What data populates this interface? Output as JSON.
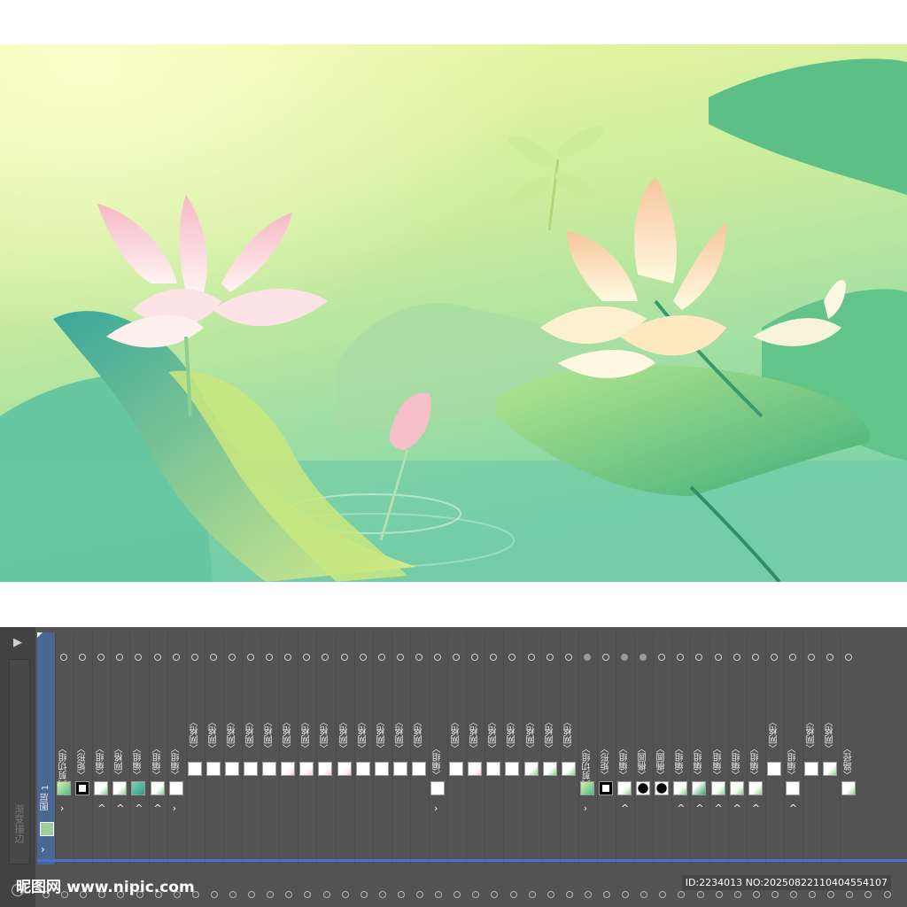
{
  "artwork": {
    "description_colors": {
      "sky_light": "#f0f7a8",
      "water": "#5fc6a6",
      "leaf_dark": "#2a9d7a",
      "lotus_pink": "#f7c9cf",
      "lotus_cream": "#fbe9c4"
    }
  },
  "panel": {
    "play_symbol": "▶",
    "side_label": "渐变描边",
    "layer_name": "图层 1",
    "accent": "#4a6fd1",
    "columns": [
      {
        "label": "〈剪切组〉",
        "thumb": "art",
        "caret": "›"
      },
      {
        "label": "〈矩形〉",
        "thumb": "frame",
        "caret": ""
      },
      {
        "label": "〈编组〉",
        "thumb": "leaf",
        "caret": "^"
      },
      {
        "label": "〈网格〉",
        "thumb": "leaf",
        "caret": "^"
      },
      {
        "label": "〈编组〉",
        "thumb": "teal",
        "caret": "^"
      },
      {
        "label": "〈编组〉",
        "thumb": "leaf",
        "caret": "^"
      },
      {
        "label": "〈编组〉",
        "thumb": "white",
        "caret": "›"
      },
      {
        "label": "〈网格〉",
        "thumb": "white",
        "caret": ""
      },
      {
        "label": "〈网格〉",
        "thumb": "white",
        "caret": ""
      },
      {
        "label": "〈网格〉",
        "thumb": "white",
        "caret": ""
      },
      {
        "label": "〈网格〉",
        "thumb": "white",
        "caret": ""
      },
      {
        "label": "〈网格〉",
        "thumb": "white",
        "caret": ""
      },
      {
        "label": "〈网格〉",
        "thumb": "pink",
        "caret": ""
      },
      {
        "label": "〈网格〉",
        "thumb": "pink",
        "caret": ""
      },
      {
        "label": "〈网格〉",
        "thumb": "pink",
        "caret": ""
      },
      {
        "label": "〈网格〉",
        "thumb": "pink",
        "caret": ""
      },
      {
        "label": "〈网格〉",
        "thumb": "white",
        "caret": ""
      },
      {
        "label": "〈网格〉",
        "thumb": "white",
        "caret": ""
      },
      {
        "label": "〈网格〉",
        "thumb": "white",
        "caret": ""
      },
      {
        "label": "〈网格〉",
        "thumb": "white",
        "caret": ""
      },
      {
        "label": "〈编组〉",
        "thumb": "white",
        "caret": "›"
      },
      {
        "label": "〈网格〉",
        "thumb": "white",
        "caret": ""
      },
      {
        "label": "〈网格〉",
        "thumb": "pink",
        "caret": ""
      },
      {
        "label": "〈网格〉",
        "thumb": "white",
        "caret": ""
      },
      {
        "label": "〈网格〉",
        "thumb": "white",
        "caret": ""
      },
      {
        "label": "〈网格〉",
        "thumb": "leaf",
        "caret": ""
      },
      {
        "label": "〈网格〉",
        "thumb": "leaf",
        "caret": ""
      },
      {
        "label": "〈网格〉",
        "thumb": "leaf",
        "caret": ""
      },
      {
        "label": "〈剪切组〉",
        "thumb": "art",
        "caret": "›"
      },
      {
        "label": "〈矩形〉",
        "thumb": "frame",
        "caret": ""
      },
      {
        "label": "〈编组〉",
        "thumb": "leaf",
        "caret": "^"
      },
      {
        "label": "〈椭圆〉",
        "thumb": "black",
        "caret": ""
      },
      {
        "label": "〈椭圆〉",
        "thumb": "black",
        "caret": ""
      },
      {
        "label": "〈编组〉",
        "thumb": "leaf",
        "caret": "^"
      },
      {
        "label": "〈编组〉",
        "thumb": "green",
        "caret": "^"
      },
      {
        "label": "〈编组〉",
        "thumb": "leaf",
        "caret": "^"
      },
      {
        "label": "〈编组〉",
        "thumb": "leaf",
        "caret": "^"
      },
      {
        "label": "〈编组〉",
        "thumb": "leaf",
        "caret": "^"
      },
      {
        "label": "〈网格〉",
        "thumb": "white",
        "caret": ""
      },
      {
        "label": "〈编组〉",
        "thumb": "white",
        "caret": "^"
      },
      {
        "label": "〈网格〉",
        "thumb": "white",
        "caret": ""
      },
      {
        "label": "〈网格〉",
        "thumb": "leaf",
        "caret": ""
      },
      {
        "label": "〈路径〉",
        "thumb": "leaf",
        "caret": ""
      }
    ]
  },
  "watermark": {
    "logo": "昵图网",
    "url": "www.nipic.com"
  },
  "image_id": "ID:2234013 NO:20250822110404554107"
}
